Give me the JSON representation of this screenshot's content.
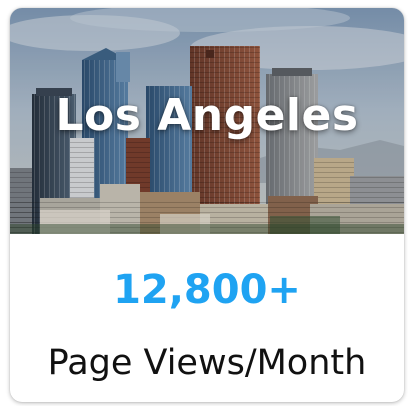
{
  "card": {
    "city": "Los Angeles",
    "stat_value": "12,800+",
    "stat_label": "Page Views/Month"
  },
  "colors": {
    "accent": "#1fa3f2",
    "label": "#111111",
    "title": "#ffffff"
  }
}
